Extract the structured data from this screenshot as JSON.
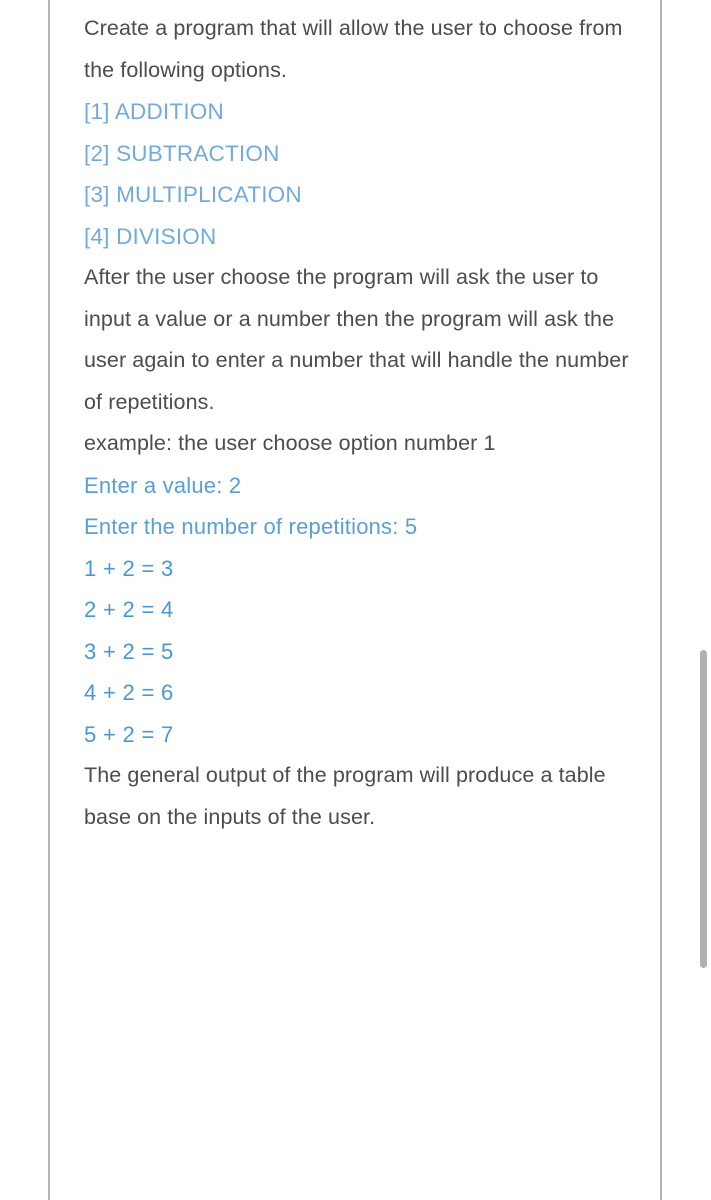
{
  "document": {
    "background_color": "#ffffff",
    "rule_color": "#b4b4b4",
    "body_text_color": "#4c4c4c",
    "option_text_color": "#72abdb",
    "prompt_text_color": "#5a9fd4",
    "equation_text_color": "#4a97d6"
  },
  "blocks": {
    "intro": "Create a program that will allow the user to choose from the following options.",
    "options": [
      "[1] ADDITION",
      "[2] SUBTRACTION",
      "[3] MULTIPLICATION",
      "[4] DIVISION"
    ],
    "description": "After the user choose the program will ask the user to input a value or a number then the program will ask the user again to enter a number that will handle the number of repetitions.",
    "example_intro": "example: the user choose option number 1",
    "prompt_value": "Enter a value: 2",
    "prompt_repetitions": "Enter the number of repetitions: 5",
    "equations": {
      "line1": "1 + 2 = 3",
      "line2": "2 + 2 = 4",
      "line3": "3 + 2 = 5",
      "line4": "4 + 2 = 6",
      "line5": "5 + 2 = 7"
    },
    "closing": "The general output of the program will produce a table base on the inputs of the user."
  },
  "scrollbar": {
    "thumb_color": "#b0b0b0",
    "position": "right"
  }
}
